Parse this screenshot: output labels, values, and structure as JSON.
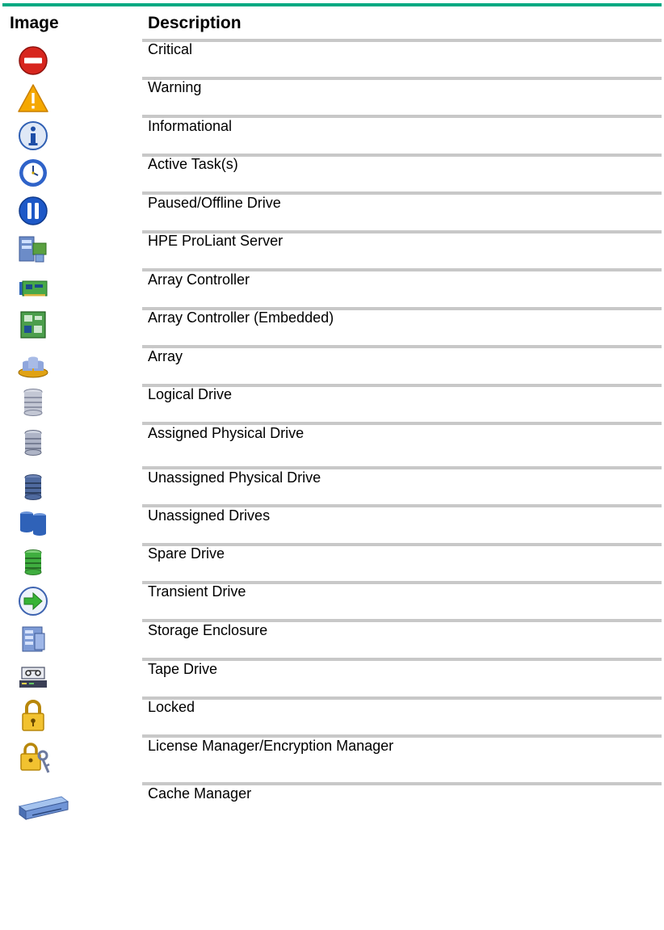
{
  "table": {
    "header": {
      "image": "Image",
      "description": "Description"
    },
    "rows": [
      {
        "icon": "critical-icon",
        "label": "Critical"
      },
      {
        "icon": "warning-icon",
        "label": "Warning"
      },
      {
        "icon": "info-icon",
        "label": "Informational"
      },
      {
        "icon": "clock-icon",
        "label": "Active Task(s)"
      },
      {
        "icon": "pause-icon",
        "label": "Paused/Offline Drive"
      },
      {
        "icon": "server-icon",
        "label": "HPE ProLiant Server"
      },
      {
        "icon": "controller-card-icon",
        "label": "Array Controller"
      },
      {
        "icon": "embedded-controller-icon",
        "label": "Array Controller (Embedded)"
      },
      {
        "icon": "array-icon",
        "label": "Array"
      },
      {
        "icon": "logical-drive-icon",
        "label": "Logical Drive"
      },
      {
        "icon": "assigned-drive-icon",
        "label": "Assigned Physical Drive"
      },
      {
        "icon": "unassigned-drive-icon",
        "label": "Unassigned Physical Drive"
      },
      {
        "icon": "unassigned-drives-icon",
        "label": "Unassigned Drives"
      },
      {
        "icon": "spare-drive-icon",
        "label": "Spare Drive"
      },
      {
        "icon": "transient-arrow-icon",
        "label": "Transient Drive"
      },
      {
        "icon": "enclosure-icon",
        "label": "Storage Enclosure"
      },
      {
        "icon": "tape-drive-icon",
        "label": "Tape Drive"
      },
      {
        "icon": "lock-icon",
        "label": "Locked"
      },
      {
        "icon": "lock-key-icon",
        "label": "License Manager/Encryption Manager"
      },
      {
        "icon": "cache-manager-icon",
        "label": "Cache Manager"
      }
    ]
  }
}
